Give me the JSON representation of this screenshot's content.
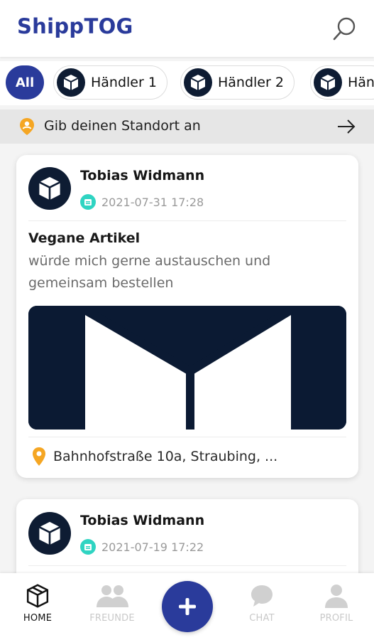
{
  "header": {
    "title": "ShippTOG",
    "search_icon": "search-icon"
  },
  "filters": {
    "all_label": "All",
    "chips": [
      {
        "label": "Händler 1",
        "icon": "box-icon"
      },
      {
        "label": "Händler 2",
        "icon": "box-icon"
      },
      {
        "label": "Hän",
        "icon": "box-icon"
      }
    ]
  },
  "location_bar": {
    "text": "Gib deinen Standort an",
    "icon": "location-pin-icon",
    "action_icon": "arrow-right-icon"
  },
  "posts": [
    {
      "author": "Tobias Widmann",
      "date": "2021-07-31 17:28",
      "title": "Vegane Artikel",
      "body": "würde mich gerne austauschen und gemeinsam bestellen",
      "location": "Bahnhofstraße 10a, Straubing, ..."
    },
    {
      "author": "Tobias Widmann",
      "date": "2021-07-19 17:22"
    }
  ],
  "nav": {
    "items": [
      {
        "label": "HOME",
        "icon": "box-icon",
        "active": true
      },
      {
        "label": "FREUNDE",
        "icon": "friends-icon",
        "active": false
      },
      {
        "label": "CHAT",
        "icon": "chat-icon",
        "active": false
      },
      {
        "label": "PROFIL",
        "icon": "profile-icon",
        "active": false
      }
    ],
    "fab_icon": "plus-icon"
  },
  "colors": {
    "brand": "#2a3b9b",
    "navy": "#0e1c33",
    "accent_teal": "#2fd4c2",
    "accent_orange": "#f5a623"
  }
}
